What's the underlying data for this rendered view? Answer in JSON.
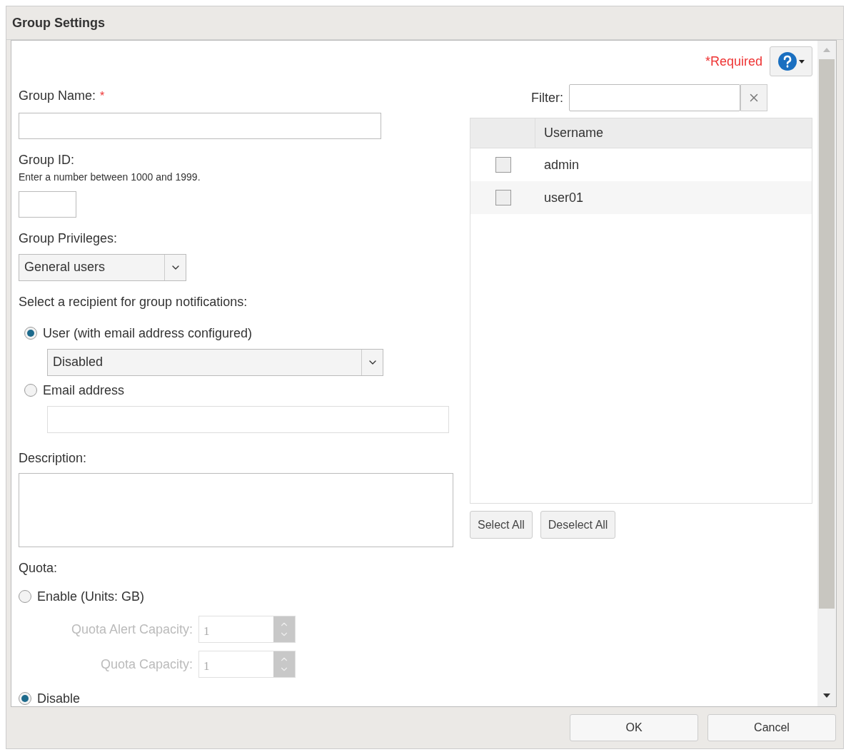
{
  "window": {
    "title": "Group Settings"
  },
  "required_note": "*Required",
  "group_name": {
    "label": "Group Name:",
    "required_mark": "*"
  },
  "group_id": {
    "label": "Group ID:",
    "hint": "Enter a number between 1000 and 1999."
  },
  "group_privileges": {
    "label": "Group Privileges:",
    "value": "General users"
  },
  "notifications": {
    "label": "Select a recipient for group notifications:",
    "options": [
      {
        "label": "User (with email address configured)",
        "selected": true,
        "kind": "select",
        "value": "Disabled"
      },
      {
        "label": "Email address",
        "selected": false,
        "kind": "input"
      }
    ]
  },
  "description": {
    "label": "Description:"
  },
  "quota": {
    "label": "Quota:",
    "options": [
      {
        "label": "Enable (Units: GB)",
        "selected": false
      },
      {
        "label": "Disable",
        "selected": true
      }
    ],
    "fields": [
      {
        "label": "Quota Alert Capacity:",
        "value": "1",
        "disabled": true
      },
      {
        "label": "Quota Capacity:",
        "value": "1",
        "disabled": true
      }
    ]
  },
  "filter": {
    "label": "Filter:"
  },
  "users_table": {
    "columns": [
      "Username"
    ],
    "rows": [
      {
        "username": "admin",
        "checked": false
      },
      {
        "username": "user01",
        "checked": false
      }
    ]
  },
  "table_buttons": [
    "Select All",
    "Deselect All"
  ],
  "footer_buttons": [
    "OK",
    "Cancel"
  ]
}
